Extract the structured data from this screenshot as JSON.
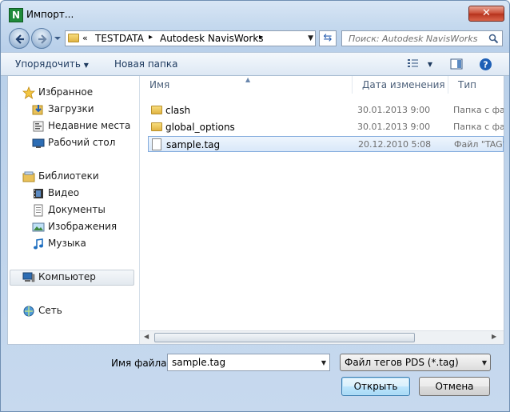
{
  "window": {
    "title": "Импорт..."
  },
  "address": {
    "overflow": "«",
    "segments": [
      "TESTDATA",
      "Autodesk NavisWorks"
    ]
  },
  "search": {
    "placeholder": "Поиск: Autodesk NavisWorks"
  },
  "toolbar": {
    "organize": "Упорядочить",
    "new_folder": "Новая папка"
  },
  "nav": {
    "favorites": {
      "label": "Избранное",
      "items": [
        "Загрузки",
        "Недавние места",
        "Рабочий стол"
      ]
    },
    "libraries": {
      "label": "Библиотеки",
      "items": [
        "Видео",
        "Документы",
        "Изображения",
        "Музыка"
      ]
    },
    "computer": "Компьютер",
    "network": "Сеть"
  },
  "columns": {
    "name": "Имя",
    "date": "Дата изменения",
    "type": "Тип"
  },
  "files": [
    {
      "name": "clash",
      "date": "30.01.2013 9:00",
      "type": "Папка с фай"
    },
    {
      "name": "global_options",
      "date": "30.01.2013 9:00",
      "type": "Папка с фай"
    },
    {
      "name": "sample.tag",
      "date": "20.12.2010 5:08",
      "type": "Файл \"TAG\""
    }
  ],
  "footer": {
    "filename_label": "Имя файла:",
    "filename_value": "sample.tag",
    "filetype_value": "Файл тегов PDS (*.tag)",
    "open_label": "Открыть",
    "cancel_label": "Отмена"
  },
  "colors": {
    "accent": "#3c7fb1",
    "selection": "#d9e8f9",
    "folder": "#e9c15a"
  }
}
